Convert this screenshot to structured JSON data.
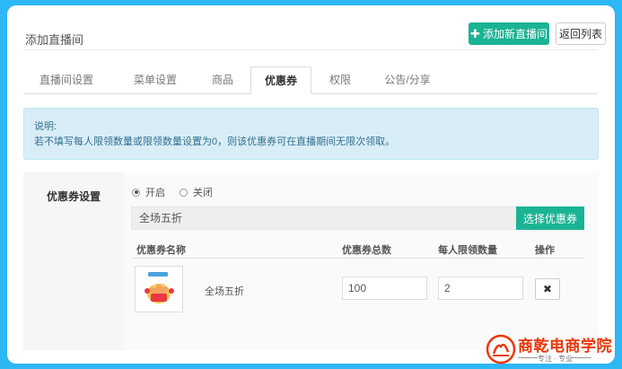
{
  "header": {
    "title": "添加直播间",
    "add_button": "添加新直播间",
    "back_button": "返回列表"
  },
  "tabs": [
    {
      "label": "直播间设置"
    },
    {
      "label": "菜单设置"
    },
    {
      "label": "商品"
    },
    {
      "label": "优惠券",
      "active": true
    },
    {
      "label": "权限"
    },
    {
      "label": "公告/分享"
    }
  ],
  "notice": {
    "title": "说明:",
    "text": "若不填写每人限领数量或限领数量设置为0，则该优惠券可在直播期间无限次领取。"
  },
  "settings": {
    "label": "优惠券设置",
    "radio_on": "开启",
    "radio_off": "关闭",
    "selected": "开启",
    "search_value": "全场五折",
    "select_button": "选择优惠券",
    "columns": {
      "name": "优惠券名称",
      "total": "优惠券总数",
      "limit": "每人限领数量",
      "action": "操作"
    },
    "rows": [
      {
        "name": "全场五折",
        "total": "100",
        "limit": "2"
      }
    ]
  },
  "watermark": {
    "brand": "商乾电商学院",
    "slogan": "专注 · 专业"
  },
  "colors": {
    "background": "#2db7f5",
    "primary": "#1ab394",
    "notice_bg": "#d9edf7",
    "brand_red": "#e8380d"
  }
}
